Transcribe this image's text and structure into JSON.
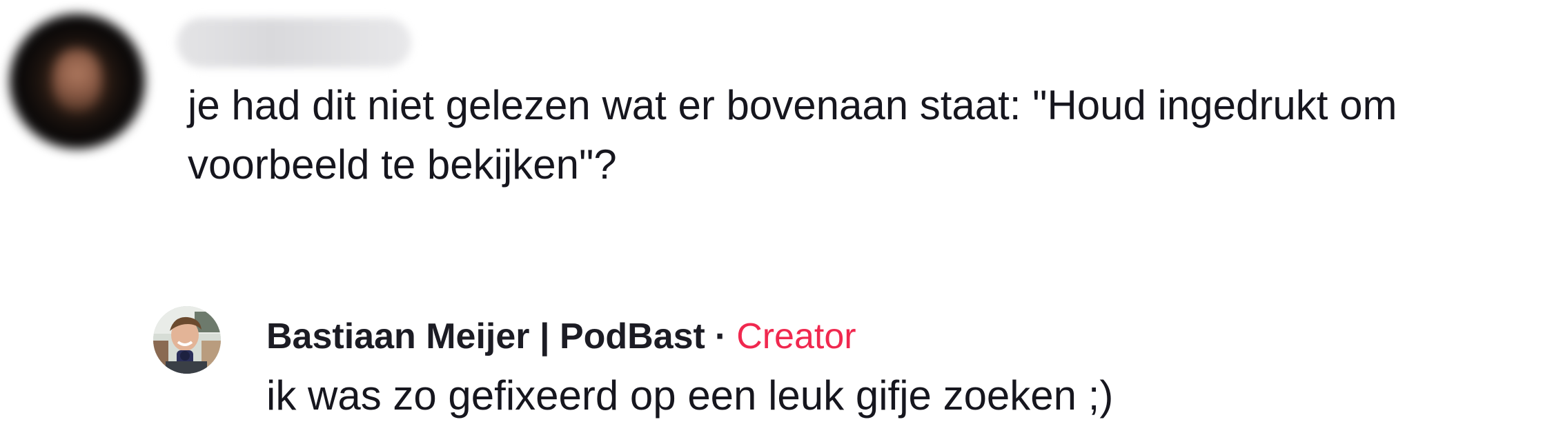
{
  "comment": {
    "avatar_icon": "user-avatar-blurred",
    "username": "kelly_poop_69",
    "text_line1": "je had dit niet gelezen wat er bovenaan staat: \"Houd ingedrukt om",
    "text_line2": "voorbeeld te bekijken\"?"
  },
  "reply": {
    "avatar_icon": "creator-avatar",
    "author": "Bastiaan Meijer | PodBast",
    "separator": "·",
    "badge": "Creator",
    "badge_color": "#f0284f",
    "text": "ik was zo gefixeerd op een leuk gifje zoeken ;)"
  }
}
